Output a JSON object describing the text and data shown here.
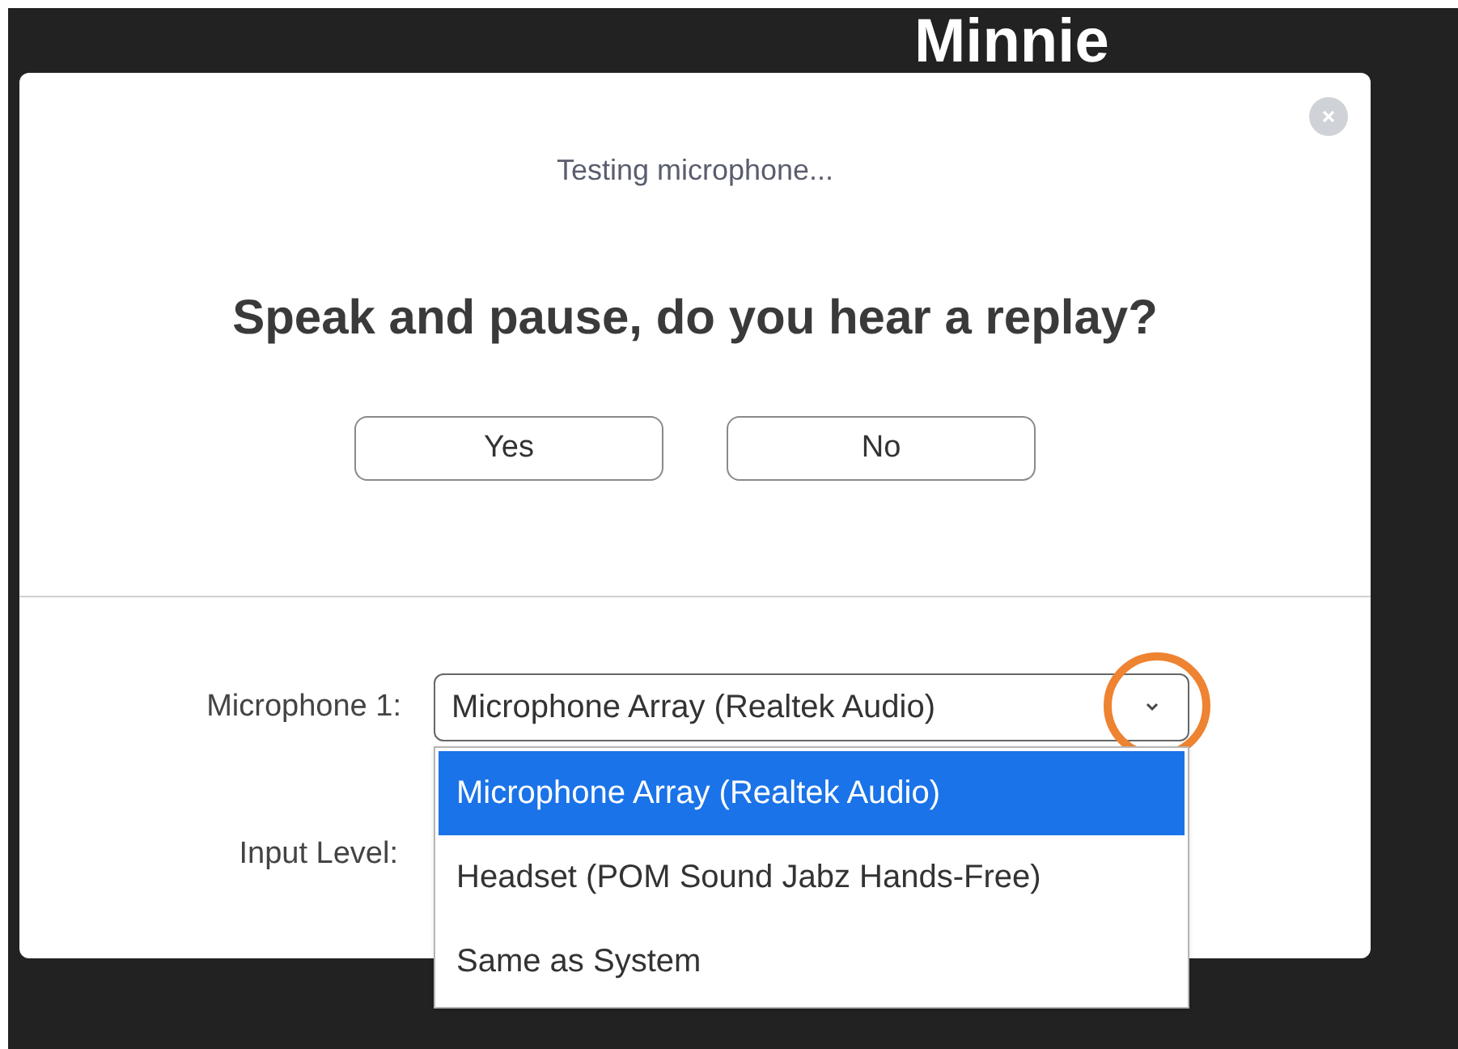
{
  "background": {
    "title": "Minnie"
  },
  "dialog": {
    "status": "Testing microphone...",
    "question": "Speak and pause, do you hear a replay?",
    "buttons": [
      "Yes",
      "No"
    ],
    "microphone": {
      "label": "Microphone 1:",
      "value": "Microphone Array (Realtek Audio)",
      "expanded": true,
      "highlighted": true,
      "options": [
        {
          "label": "Microphone Array (Realtek Audio)",
          "selected": true
        },
        {
          "label": "Headset (POM Sound Jabz Hands-Free)",
          "selected": false
        },
        {
          "label": "Same as System",
          "selected": false
        }
      ]
    },
    "input_level": {
      "label": "Input Level:"
    }
  }
}
